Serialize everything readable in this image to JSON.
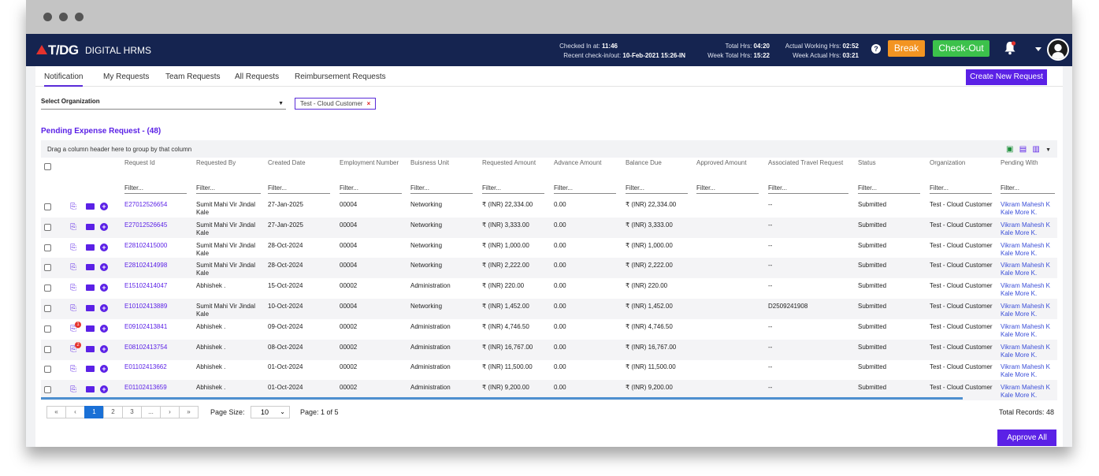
{
  "header": {
    "logo": "T/DG",
    "app_name": "DIGITAL HRMS",
    "checked_in_label": "Checked In at:",
    "checked_in_value": "11:46",
    "recent_label": "Recent check-in/out:",
    "recent_value": "10-Feb-2021 15:26-IN",
    "total_hrs_label": "Total Hrs:",
    "total_hrs_value": "04:20",
    "week_total_label": "Week Total Hrs:",
    "week_total_value": "15:22",
    "actual_label": "Actual Working Hrs:",
    "actual_value": "02:52",
    "week_actual_label": "Week Actual Hrs:",
    "week_actual_value": "03:21",
    "help_label": "?",
    "break_label": "Break",
    "checkout_label": "Check-Out",
    "colors": {
      "nav": "#152450",
      "break": "#f39422",
      "checkout": "#3cc14b"
    }
  },
  "tabs": [
    "Notification",
    "My Requests",
    "Team Requests",
    "All Requests",
    "Reimbursement Requests"
  ],
  "create_label": "Create New Request",
  "org_select": {
    "label": "Select Organization",
    "chip": "Test - Cloud Customer"
  },
  "section_title": "Pending Expense Request - (48)",
  "group_hint": "Drag a column header here to group by that column",
  "columns": [
    {
      "label": "Request Id"
    },
    {
      "label": "Requested By"
    },
    {
      "label": "Created Date"
    },
    {
      "label": "Employment Number"
    },
    {
      "label": "Buisness Unit"
    },
    {
      "label": "Requested Amount"
    },
    {
      "label": "Advance Amount"
    },
    {
      "label": "Balance Due"
    },
    {
      "label": "Approved Amount"
    },
    {
      "label": "Associated Travel Request"
    },
    {
      "label": "Status"
    },
    {
      "label": "Organization"
    },
    {
      "label": "Pending With"
    }
  ],
  "filter_label": "Filter...",
  "rows": [
    {
      "id": "E27012526654",
      "by": "Sumit Mahi Vir Jindal Kale",
      "date": "27-Jan-2025",
      "emp": "00004",
      "bu": "Networking",
      "req": "₹ (INR) 22,334.00",
      "adv": "0.00",
      "bal": "₹ (INR) 22,334.00",
      "appr": "",
      "travel": "--",
      "status": "Submitted",
      "org": "Test - Cloud Customer",
      "pending": "Vikram Mahesh K Kale More K.",
      "badge": ""
    },
    {
      "id": "E27012526645",
      "by": "Sumit Mahi Vir Jindal Kale",
      "date": "27-Jan-2025",
      "emp": "00004",
      "bu": "Networking",
      "req": "₹ (INR) 3,333.00",
      "adv": "0.00",
      "bal": "₹ (INR) 3,333.00",
      "appr": "",
      "travel": "--",
      "status": "Submitted",
      "org": "Test - Cloud Customer",
      "pending": "Vikram Mahesh K Kale More K.",
      "badge": ""
    },
    {
      "id": "E28102415000",
      "by": "Sumit Mahi Vir Jindal Kale",
      "date": "28-Oct-2024",
      "emp": "00004",
      "bu": "Networking",
      "req": "₹ (INR) 1,000.00",
      "adv": "0.00",
      "bal": "₹ (INR) 1,000.00",
      "appr": "",
      "travel": "--",
      "status": "Submitted",
      "org": "Test - Cloud Customer",
      "pending": "Vikram Mahesh K Kale More K.",
      "badge": ""
    },
    {
      "id": "E28102414998",
      "by": "Sumit Mahi Vir Jindal Kale",
      "date": "28-Oct-2024",
      "emp": "00004",
      "bu": "Networking",
      "req": "₹ (INR) 2,222.00",
      "adv": "0.00",
      "bal": "₹ (INR) 2,222.00",
      "appr": "",
      "travel": "--",
      "status": "Submitted",
      "org": "Test - Cloud Customer",
      "pending": "Vikram Mahesh K Kale More K.",
      "badge": ""
    },
    {
      "id": "E15102414047",
      "by": "Abhishek .",
      "date": "15-Oct-2024",
      "emp": "00002",
      "bu": "Administration",
      "req": "₹ (INR) 220.00",
      "adv": "0.00",
      "bal": "₹ (INR) 220.00",
      "appr": "",
      "travel": "--",
      "status": "Submitted",
      "org": "Test - Cloud Customer",
      "pending": "Vikram Mahesh K Kale More K.",
      "badge": ""
    },
    {
      "id": "E10102413889",
      "by": "Sumit Mahi Vir Jindal Kale",
      "date": "10-Oct-2024",
      "emp": "00004",
      "bu": "Networking",
      "req": "₹ (INR) 1,452.00",
      "adv": "0.00",
      "bal": "₹ (INR) 1,452.00",
      "appr": "",
      "travel": "D2509241908",
      "status": "Submitted",
      "org": "Test - Cloud Customer",
      "pending": "Vikram Mahesh K Kale More K.",
      "badge": ""
    },
    {
      "id": "E09102413841",
      "by": "Abhishek .",
      "date": "09-Oct-2024",
      "emp": "00002",
      "bu": "Administration",
      "req": "₹ (INR) 4,746.50",
      "adv": "0.00",
      "bal": "₹ (INR) 4,746.50",
      "appr": "",
      "travel": "--",
      "status": "Submitted",
      "org": "Test - Cloud Customer",
      "pending": "Vikram Mahesh K Kale More K.",
      "badge": "1"
    },
    {
      "id": "E08102413754",
      "by": "Abhishek .",
      "date": "08-Oct-2024",
      "emp": "00002",
      "bu": "Administration",
      "req": "₹ (INR) 16,767.00",
      "adv": "0.00",
      "bal": "₹ (INR) 16,767.00",
      "appr": "",
      "travel": "--",
      "status": "Submitted",
      "org": "Test - Cloud Customer",
      "pending": "Vikram Mahesh K Kale More K.",
      "badge": "2"
    },
    {
      "id": "E01102413662",
      "by": "Abhishek .",
      "date": "01-Oct-2024",
      "emp": "00002",
      "bu": "Administration",
      "req": "₹ (INR) 11,500.00",
      "adv": "0.00",
      "bal": "₹ (INR) 11,500.00",
      "appr": "",
      "travel": "--",
      "status": "Submitted",
      "org": "Test - Cloud Customer",
      "pending": "Vikram Mahesh K Kale More K.",
      "badge": ""
    },
    {
      "id": "E01102413659",
      "by": "Abhishek .",
      "date": "01-Oct-2024",
      "emp": "00002",
      "bu": "Administration",
      "req": "₹ (INR) 9,200.00",
      "adv": "0.00",
      "bal": "₹ (INR) 9,200.00",
      "appr": "",
      "travel": "--",
      "status": "Submitted",
      "org": "Test - Cloud Customer",
      "pending": "Vikram Mahesh K Kale More K.",
      "badge": ""
    }
  ],
  "pager": {
    "buttons": [
      "«",
      "‹",
      "1",
      "2",
      "3",
      "...",
      "›",
      "»"
    ],
    "current": "1",
    "page_size_label": "Page Size:",
    "page_size": "10",
    "page_info": "Page: 1 of 5",
    "total_records": "Total Records: 48"
  },
  "approve_label": "Approve All"
}
